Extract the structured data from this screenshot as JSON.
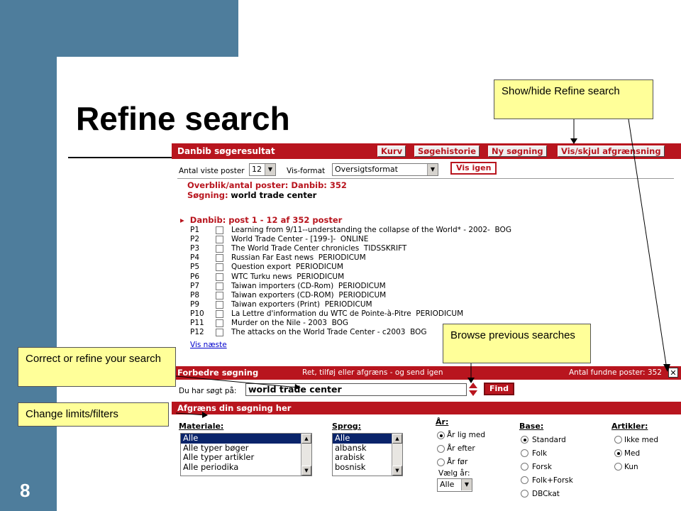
{
  "slide": {
    "title": "Refine search",
    "page_number": "8"
  },
  "callouts": {
    "show_hide": "Show/hide Refine search",
    "browse": "Browse previous searches",
    "correct": "Correct or refine your search",
    "limits": "Change limits/filters"
  },
  "topbar": {
    "title": "Danbib søgeresultat",
    "buttons": [
      "Kurv",
      "Søgehistorie",
      "Ny søgning",
      "Vis/skjul afgrænsning"
    ]
  },
  "controls": {
    "antal_label": "Antal viste poster",
    "antal_value": "12",
    "visformat_label": "Vis-format",
    "visformat_value": "Oversigtsformat",
    "vis_igen": "Vis igen"
  },
  "overview": {
    "line1_label": "Overblik/antal poster: Danbib: 352",
    "line2_label": "Søgning:",
    "line2_value": "world trade center"
  },
  "results": {
    "header": "Danbib: post 1 - 12 af 352 poster",
    "rows": [
      {
        "id": "P1",
        "title": "Learning from 9/11--understanding the collapse of the World* - 2002-",
        "type": "BOG"
      },
      {
        "id": "P2",
        "title": "World Trade Center - [199-]-",
        "type": "ONLINE"
      },
      {
        "id": "P3",
        "title": "The World Trade Center chronicles",
        "type": "TIDSSKRIFT"
      },
      {
        "id": "P4",
        "title": "Russian Far East news",
        "type": "PERIODICUM"
      },
      {
        "id": "P5",
        "title": "Question export",
        "type": "PERIODICUM"
      },
      {
        "id": "P6",
        "title": "WTC Turku news",
        "type": "PERIODICUM"
      },
      {
        "id": "P7",
        "title": "Taiwan importers (CD-Rom)",
        "type": "PERIODICUM"
      },
      {
        "id": "P8",
        "title": "Taiwan exporters (CD-ROM)",
        "type": "PERIODICUM"
      },
      {
        "id": "P9",
        "title": "Taiwan exporters (Print)",
        "type": "PERIODICUM"
      },
      {
        "id": "P10",
        "title": "La Lettre d'information du WTC de Pointe-à-Pitre",
        "type": "PERIODICUM"
      },
      {
        "id": "P11",
        "title": "Murder on the Nile - 2003",
        "type": "BOG"
      },
      {
        "id": "P12",
        "title": "The attacks on the World Trade Center - c2003",
        "type": "BOG"
      }
    ],
    "vis_naeste": "Vis næste"
  },
  "forbedre": {
    "title": "Forbedre søgning",
    "hint": "Ret, tilføj eller afgræns - og send igen",
    "count": "Antal fundne poster: 352",
    "searched_label": "Du har søgt på:",
    "search_value": "world trade center",
    "find": "Find"
  },
  "afgraens": {
    "title": "Afgræns din søgning her",
    "materiale_label": "Materiale:",
    "materiale_options": [
      "Alle",
      "Alle typer bøger",
      "Alle typer artikler",
      "Alle periodika"
    ],
    "sprog_label": "Sprog:",
    "sprog_options": [
      "Alle",
      "albansk",
      "arabisk",
      "bosnisk"
    ],
    "aar_label": "År:",
    "aar_options": [
      "År lig med",
      "År efter",
      "År før"
    ],
    "vaelg_aar": "Vælg år:",
    "vaelg_aar_value": "Alle",
    "base_label": "Base:",
    "base_options": [
      "Standard",
      "Folk",
      "Forsk",
      "Folk+Forsk",
      "DBCkat"
    ],
    "artikler_label": "Artikler:",
    "artikler_options": [
      "Ikke med",
      "Med",
      "Kun"
    ]
  },
  "colors": {
    "slide_blue": "#4e7d9c",
    "bar_red": "#b8151e",
    "callout_yellow": "#ffff99"
  }
}
